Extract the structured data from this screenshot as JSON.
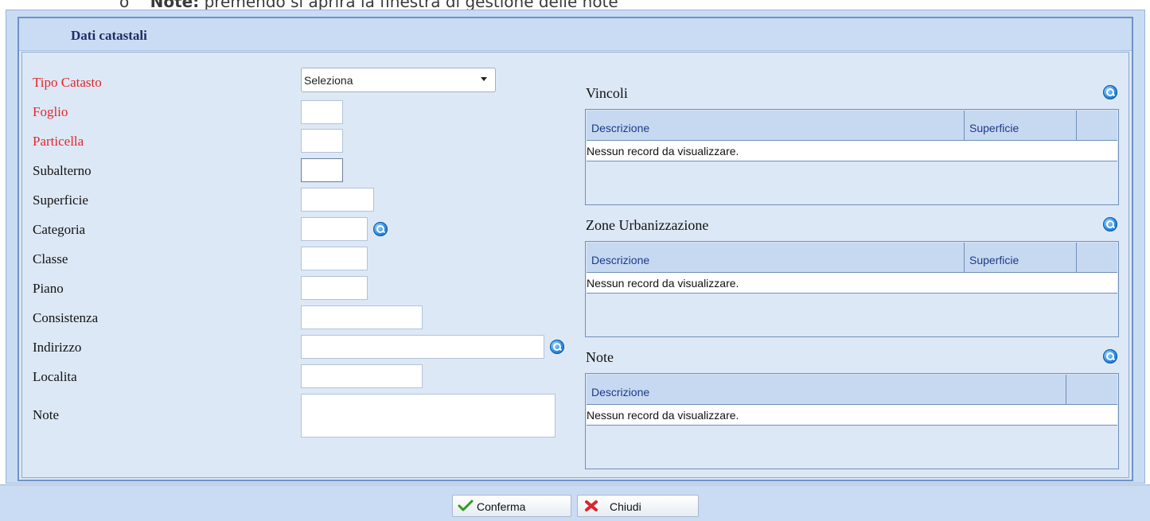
{
  "top_text": {
    "bullet": "o",
    "bold": "Note:",
    "rest": "premendo     si aprirà la finestra di gestione delle note"
  },
  "panel": {
    "title": "Dati catastali"
  },
  "form": {
    "tipo_catasto_label": "Tipo Catasto",
    "tipo_catasto_value": "Seleziona",
    "foglio_label": "Foglio",
    "particella_label": "Particella",
    "subalterno_label": "Subalterno",
    "superficie_label": "Superficie",
    "categoria_label": "Categoria",
    "classe_label": "Classe",
    "piano_label": "Piano",
    "consistenza_label": "Consistenza",
    "indirizzo_label": "Indirizzo",
    "localita_label": "Localita",
    "note_label": "Note"
  },
  "vincoli": {
    "title": "Vincoli",
    "col_descrizione": "Descrizione",
    "col_superficie": "Superficie",
    "empty": "Nessun record da visualizzare."
  },
  "zone": {
    "title": "Zone Urbanizzazione",
    "col_descrizione": "Descrizione",
    "col_superficie": "Superficie",
    "empty": "Nessun record da visualizzare."
  },
  "note_grid": {
    "title": "Note",
    "col_descrizione": "Descrizione",
    "empty": "Nessun record da visualizzare."
  },
  "footer": {
    "confirm_label": "Conferma",
    "close_label": "Chiudi"
  },
  "colors": {
    "required_label": "#e3262a",
    "panel_bg": "#c9dcf4",
    "header_text": "#1f2d63"
  },
  "icons": {
    "search": "magnifier-icon",
    "confirm": "checkmark-icon",
    "close": "x-icon"
  }
}
